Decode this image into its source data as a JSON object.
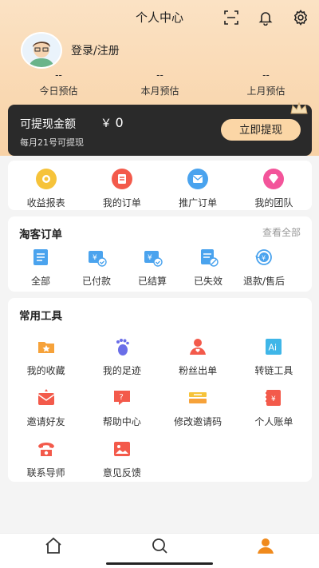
{
  "header": {
    "title": "个人中心",
    "icons": [
      "scan-icon",
      "bell-icon",
      "gear-icon"
    ]
  },
  "user": {
    "login_label": "登录/注册"
  },
  "stats": [
    {
      "value": "--",
      "label": "今日预估"
    },
    {
      "value": "--",
      "label": "本月预估"
    },
    {
      "value": "--",
      "label": "上月预估"
    }
  ],
  "withdraw": {
    "label": "可提现金额",
    "currency": "￥",
    "amount": "0",
    "note": "每月21号可提现",
    "button": "立即提现"
  },
  "quick": [
    {
      "label": "收益报表",
      "icon": "income-report-icon",
      "color": "#f6c33a"
    },
    {
      "label": "我的订单",
      "icon": "my-orders-icon",
      "color": "#f35a4b"
    },
    {
      "label": "推广订单",
      "icon": "promo-orders-icon",
      "color": "#4aa3ee"
    },
    {
      "label": "我的团队",
      "icon": "team-icon",
      "color": "#f3549a"
    }
  ],
  "taoke": {
    "title": "淘客订单",
    "more": "查看全部",
    "items": [
      {
        "label": "全部",
        "icon": "list-icon"
      },
      {
        "label": "已付款",
        "icon": "paid-icon"
      },
      {
        "label": "已结算",
        "icon": "settled-icon"
      },
      {
        "label": "已失效",
        "icon": "invalid-icon"
      },
      {
        "label": "退款/售后",
        "icon": "refund-icon"
      }
    ]
  },
  "tools": {
    "title": "常用工具",
    "rows": [
      [
        {
          "label": "我的收藏",
          "icon": "favorites-icon"
        },
        {
          "label": "我的足迹",
          "icon": "footprint-icon"
        },
        {
          "label": "粉丝出单",
          "icon": "fans-order-icon"
        },
        {
          "label": "转链工具",
          "icon": "ai-link-icon"
        }
      ],
      [
        {
          "label": "邀请好友",
          "icon": "invite-icon"
        },
        {
          "label": "帮助中心",
          "icon": "help-icon"
        },
        {
          "label": "修改邀请码",
          "icon": "invite-code-icon"
        },
        {
          "label": "个人账单",
          "icon": "bill-icon"
        }
      ],
      [
        {
          "label": "联系导师",
          "icon": "phone-icon"
        },
        {
          "label": "意见反馈",
          "icon": "feedback-icon"
        }
      ]
    ]
  },
  "nav": {
    "tabs": [
      "home-tab",
      "search-tab",
      "profile-tab"
    ],
    "active": "profile-tab",
    "accent": "#f08a1c"
  }
}
